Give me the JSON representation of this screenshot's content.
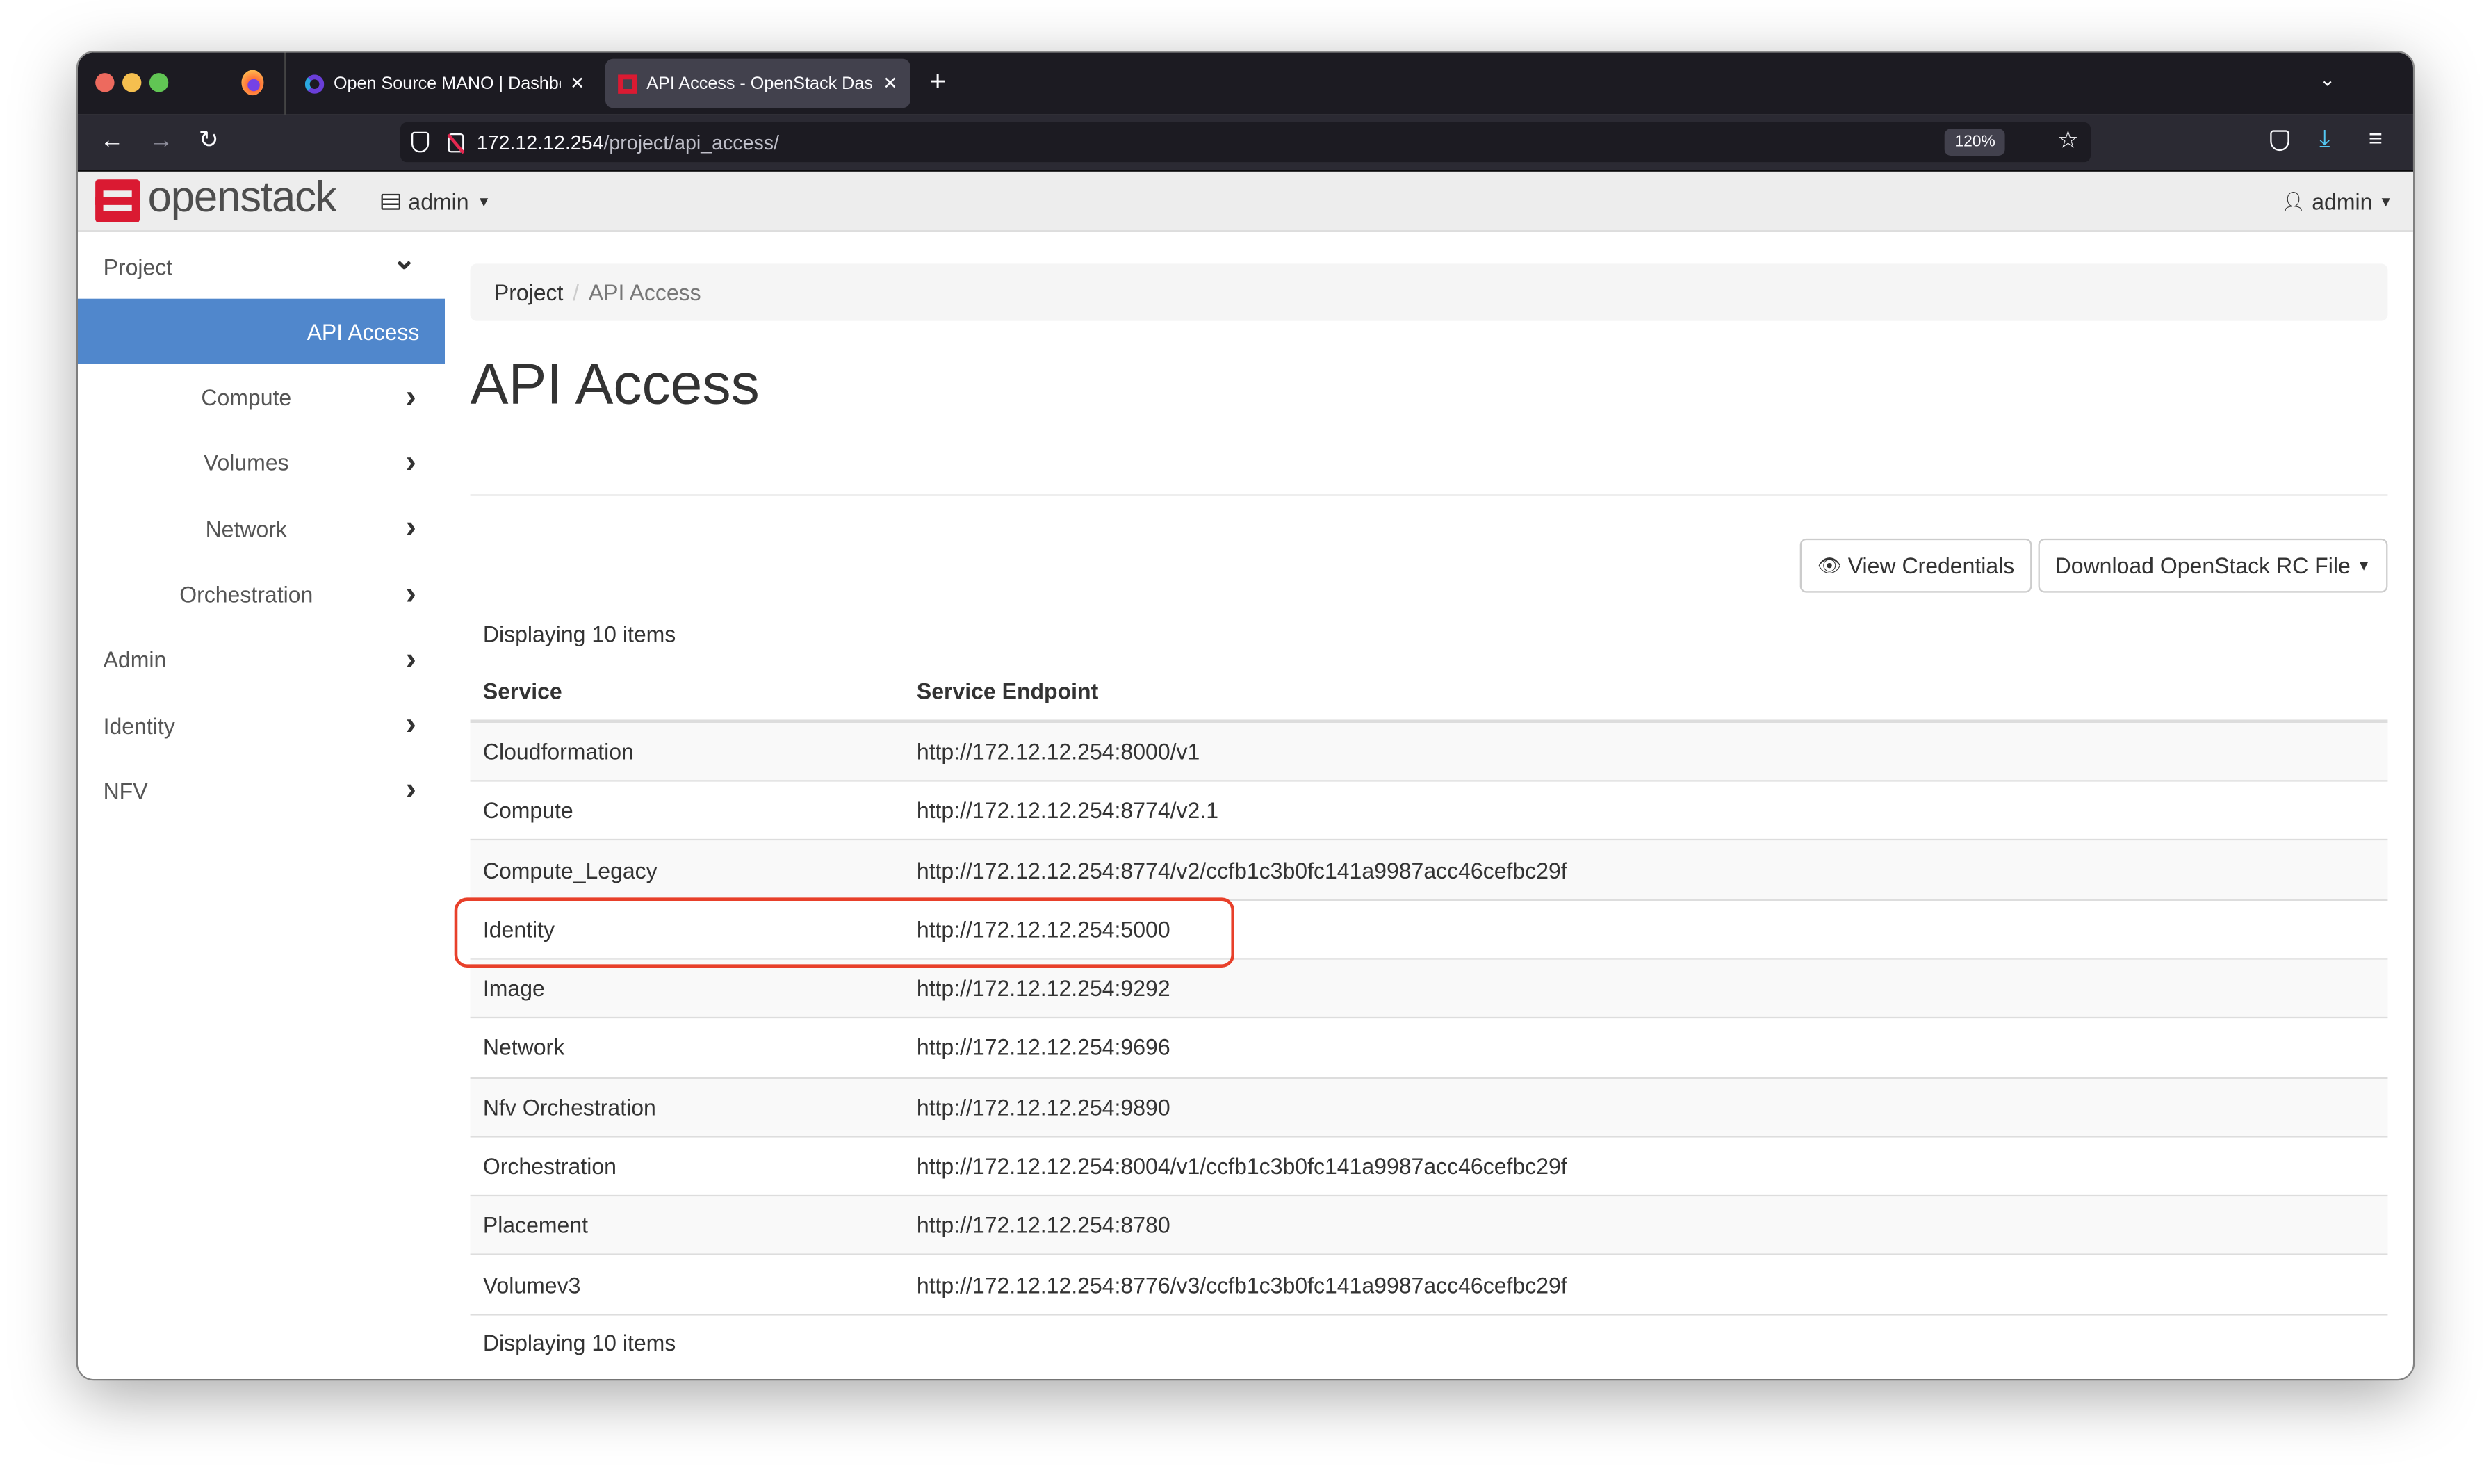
{
  "browser": {
    "tabs": [
      {
        "title": "Open Source MANO | Dashboard",
        "active": false
      },
      {
        "title": "API Access - OpenStack Dashboard",
        "active": true
      }
    ],
    "url_host": "172.12.12.254",
    "url_path": "/project/api_access/",
    "zoom": "120%"
  },
  "header": {
    "logo": "openstack",
    "project_selector": "admin",
    "user_menu": "admin"
  },
  "sidebar": {
    "items": [
      {
        "label": "Project",
        "level": 0,
        "icon": "chevron-down"
      },
      {
        "label": "API Access",
        "level": 1,
        "active": true
      },
      {
        "label": "Compute",
        "level": 1,
        "icon": "chevron-right"
      },
      {
        "label": "Volumes",
        "level": 1,
        "icon": "chevron-right"
      },
      {
        "label": "Network",
        "level": 1,
        "icon": "chevron-right"
      },
      {
        "label": "Orchestration",
        "level": 1,
        "icon": "chevron-right"
      },
      {
        "label": "Admin",
        "level": 0,
        "icon": "chevron-right"
      },
      {
        "label": "Identity",
        "level": 0,
        "icon": "chevron-right"
      },
      {
        "label": "NFV",
        "level": 0,
        "icon": "chevron-right"
      }
    ]
  },
  "main": {
    "breadcrumb": [
      "Project",
      "API Access"
    ],
    "title": "API Access",
    "view_credentials": "View Credentials",
    "download_rc": "Download OpenStack RC File",
    "count_top": "Displaying 10 items",
    "count_bottom": "Displaying 10 items",
    "columns": [
      "Service",
      "Service Endpoint"
    ],
    "rows": [
      [
        "Cloudformation",
        "http://172.12.12.254:8000/v1"
      ],
      [
        "Compute",
        "http://172.12.12.254:8774/v2.1"
      ],
      [
        "Compute_Legacy",
        "http://172.12.12.254:8774/v2/ccfb1c3b0fc141a9987acc46cefbc29f"
      ],
      [
        "Identity",
        "http://172.12.12.254:5000"
      ],
      [
        "Image",
        "http://172.12.12.254:9292"
      ],
      [
        "Network",
        "http://172.12.12.254:9696"
      ],
      [
        "Nfv Orchestration",
        "http://172.12.12.254:9890"
      ],
      [
        "Orchestration",
        "http://172.12.12.254:8004/v1/ccfb1c3b0fc141a9987acc46cefbc29f"
      ],
      [
        "Placement",
        "http://172.12.12.254:8780"
      ],
      [
        "Volumev3",
        "http://172.12.12.254:8776/v3/ccfb1c3b0fc141a9987acc46cefbc29f"
      ]
    ],
    "highlighted_row": "Identity"
  },
  "colors": {
    "accent": "#5087cc",
    "highlight": "#e8402a",
    "brand": "#da1a32"
  }
}
